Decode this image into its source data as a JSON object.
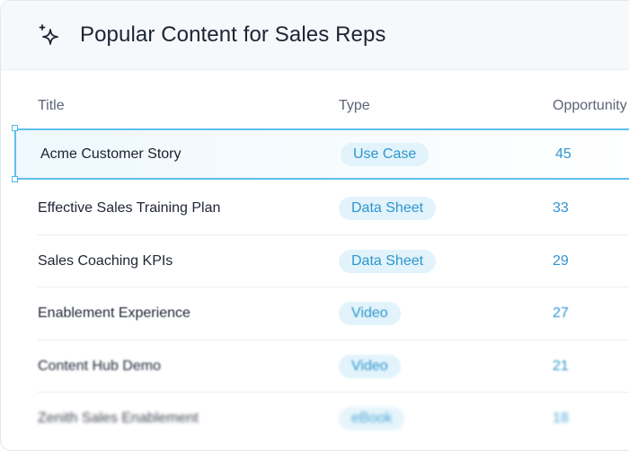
{
  "header": {
    "title": "Popular Content for Sales Reps",
    "icon": "sparkle-icon"
  },
  "columns": {
    "title": "Title",
    "type": "Type",
    "opportunity": "Opportunity"
  },
  "rows": [
    {
      "title": "Acme Customer Story",
      "type": "Use Case",
      "opportunity": "45",
      "selected": true
    },
    {
      "title": "Effective Sales Training Plan",
      "type": "Data Sheet",
      "opportunity": "33"
    },
    {
      "title": "Sales Coaching KPIs",
      "type": "Data Sheet",
      "opportunity": "29"
    },
    {
      "title": "Enablement Experience",
      "type": "Video",
      "opportunity": "27"
    },
    {
      "title": "Content Hub Demo",
      "type": "Video",
      "opportunity": "21"
    },
    {
      "title": "Zenith Sales Enablement",
      "type": "eBook",
      "opportunity": "18"
    }
  ],
  "colors": {
    "accent": "#2d96cf",
    "tag_bg": "#e2f3fb",
    "selection": "#5ec0ef",
    "header_bg": "#f6f8fc"
  }
}
